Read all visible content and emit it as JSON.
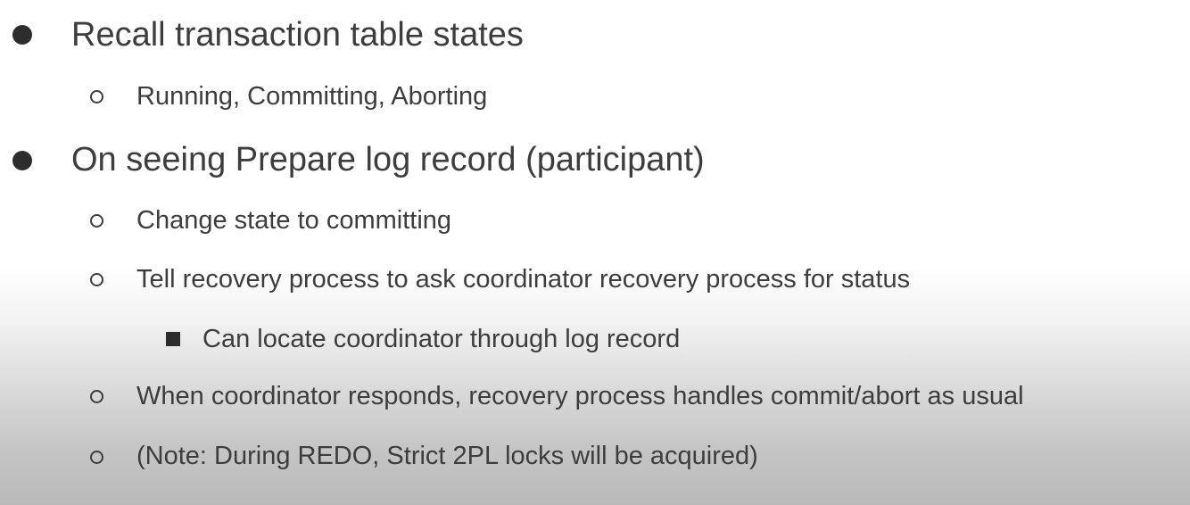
{
  "bullets": [
    {
      "level": 1,
      "text": "Recall transaction table states"
    },
    {
      "level": 2,
      "text": "Running, Committing, Aborting"
    },
    {
      "level": 1,
      "text": "On seeing Prepare log record (participant)"
    },
    {
      "level": 2,
      "text": "Change state to committing"
    },
    {
      "level": 2,
      "text": "Tell recovery process to ask coordinator recovery process for status"
    },
    {
      "level": 3,
      "text": "Can locate coordinator through log record"
    },
    {
      "level": 2,
      "text": "When coordinator responds, recovery process handles commit/abort as usual"
    },
    {
      "level": 2,
      "text": "(Note: During REDO, Strict 2PL locks will be acquired)"
    }
  ],
  "markers": {
    "level1": "filled-circle-bullet-icon",
    "level2": "hollow-circle-bullet-icon",
    "level3": "filled-square-bullet-icon"
  }
}
